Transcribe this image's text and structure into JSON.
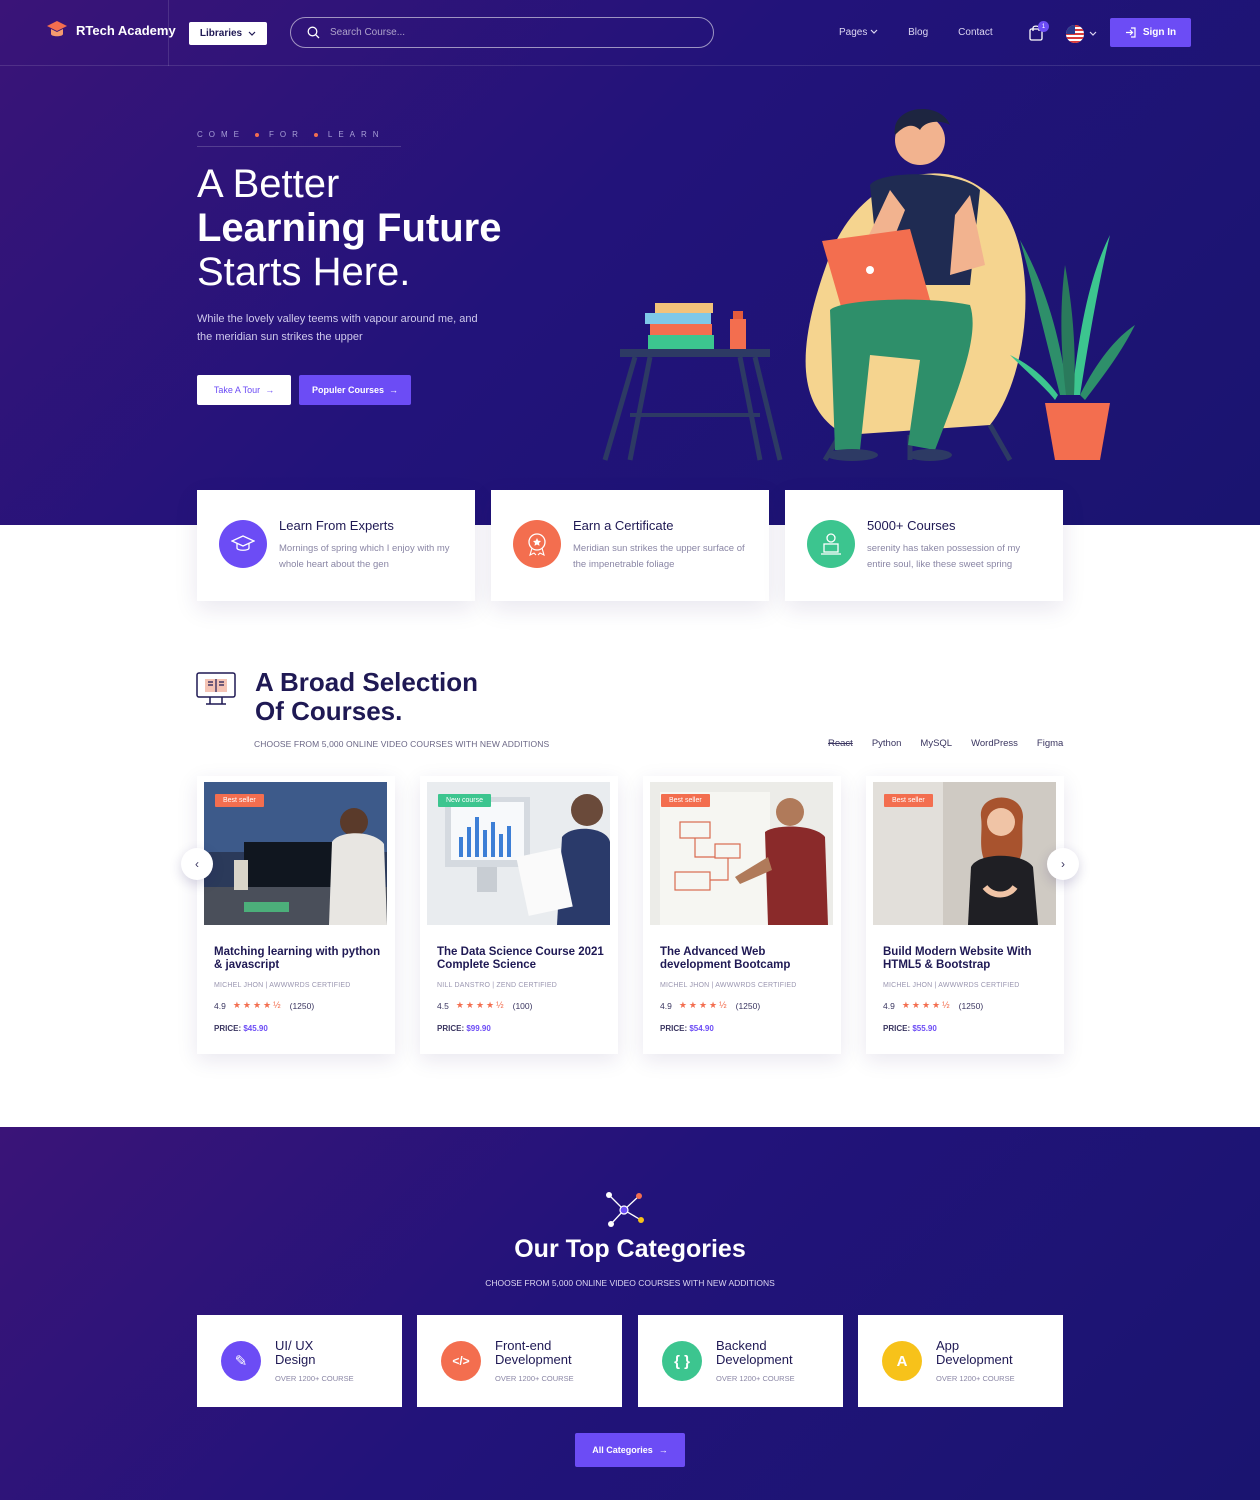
{
  "brand": {
    "name": "RTech Academy",
    "accent": "#6c4cf5",
    "orange": "#f36e4f",
    "navy": "#1f1954"
  },
  "nav": {
    "libraries_label": "Libraries",
    "search_placeholder": "Search Course...",
    "links": [
      "Pages",
      "Blog",
      "Contact"
    ],
    "cart_count": "1",
    "signin_label": "Sign In"
  },
  "hero": {
    "kicker": [
      "COME",
      "FOR",
      "LEARN"
    ],
    "title_line1": "A Better",
    "title_line2": "Learning Future",
    "title_line3": "Starts Here.",
    "paragraph": "While the lovely valley teems with vapour around me, and the meridian sun strikes the upper",
    "tour_label": "Take A Tour",
    "popular_label": "Populer Courses"
  },
  "features": [
    {
      "title": "Learn From Experts",
      "desc": "Mornings of spring which I enjoy with my whole heart about the gen",
      "icon": "graduation-cap-icon",
      "color": "#6c4cf5"
    },
    {
      "title": "Earn a Certificate",
      "desc": "Meridian sun strikes the upper surface of the impenetrable foliage",
      "icon": "certificate-icon",
      "color": "#f36e4f"
    },
    {
      "title": "5000+ Courses",
      "desc": "serenity has taken possession of my entire soul, like these sweet spring",
      "icon": "laptop-user-icon",
      "color": "#3cc58f"
    }
  ],
  "courses_section": {
    "title_line1": "A Broad Selection",
    "title_line2": "Of Courses.",
    "subtitle": "CHOOSE FROM 5,000 ONLINE VIDEO COURSES WITH NEW ADDITIONS",
    "tabs": [
      "React",
      "Python",
      "MySQL",
      "WordPress",
      "Figma"
    ],
    "active_tab": "React"
  },
  "courses": [
    {
      "badge": "Best seller",
      "badge_color": "#f36e4f",
      "title": "Matching learning with python & javascript",
      "meta": "MICHEL JHON  |  AWWWRDS CERTIFIED",
      "rating": "4.9",
      "stars": "★★★★½",
      "reviews": "(1250)",
      "price_label": "PRICE:",
      "price": "$45.90"
    },
    {
      "badge": "New course",
      "badge_color": "#3cc58f",
      "title": "The Data Science Course 2021 Complete Science",
      "meta": "NILL DANSTRO |  ZEND CERTIFIED",
      "rating": "4.5",
      "stars": "★★★★½",
      "reviews": "(100)",
      "price_label": "PRICE:",
      "price": "$99.90"
    },
    {
      "badge": "Best seller",
      "badge_color": "#f36e4f",
      "title": "The Advanced Web development Bootcamp",
      "meta": "MICHEL JHON  |  AWWWRDS CERTIFIED",
      "rating": "4.9",
      "stars": "★★★★½",
      "reviews": "(1250)",
      "price_label": "PRICE:",
      "price": "$54.90"
    },
    {
      "badge": "Best seller",
      "badge_color": "#f36e4f",
      "title": "Build Modern Website With HTML5 & Bootstrap",
      "meta": "MICHEL JHON  |  AWWWRDS CERTIFIED",
      "rating": "4.9",
      "stars": "★★★★½",
      "reviews": "(1250)",
      "price_label": "PRICE:",
      "price": "$55.90"
    }
  ],
  "categories_section": {
    "title": "Our Top Categories",
    "subtitle": "CHOOSE FROM 5,000 ONLINE VIDEO COURSES WITH NEW ADDITIONS",
    "all_label": "All Categories"
  },
  "categories": [
    {
      "title_line1": "UI/ UX",
      "title_line2": "Design",
      "sub": "OVER 1200+ COURSE",
      "color": "#6c4cf5",
      "glyph": "✎",
      "icon": "pen-tool-icon"
    },
    {
      "title_line1": "Front-end",
      "title_line2": "Development",
      "sub": "OVER 1200+ COURSE",
      "color": "#f36e4f",
      "glyph": "</>",
      "icon": "code-icon"
    },
    {
      "title_line1": "Backend",
      "title_line2": "Development",
      "sub": "OVER 1200+ COURSE",
      "color": "#3cc58f",
      "glyph": "{ }",
      "icon": "braces-icon"
    },
    {
      "title_line1": "App",
      "title_line2": "Development",
      "sub": "OVER 1200+ COURSE",
      "color": "#f7c21a",
      "glyph": "A",
      "icon": "app-store-icon"
    }
  ]
}
